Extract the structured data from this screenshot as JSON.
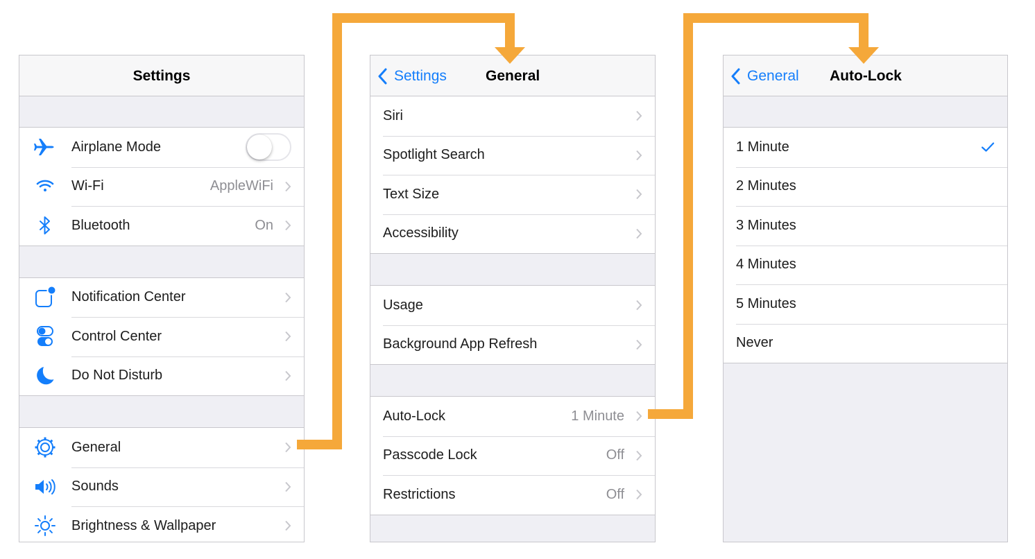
{
  "colors": {
    "accent": "#147efb",
    "connector": "#f5a83a",
    "background": "#efeff4",
    "secondary_text": "#8e8e93"
  },
  "screens": {
    "settings": {
      "title": "Settings",
      "groups": [
        [
          {
            "label": "Airplane Mode",
            "icon": "airplane-icon",
            "control": "toggle",
            "toggle_on": false
          },
          {
            "label": "Wi-Fi",
            "icon": "wifi-icon",
            "value": "AppleWiFi"
          },
          {
            "label": "Bluetooth",
            "icon": "bluetooth-icon",
            "value": "On"
          }
        ],
        [
          {
            "label": "Notification Center",
            "icon": "notification-center-icon"
          },
          {
            "label": "Control Center",
            "icon": "control-center-icon"
          },
          {
            "label": "Do Not Disturb",
            "icon": "moon-icon"
          }
        ],
        [
          {
            "label": "General",
            "icon": "gear-icon"
          },
          {
            "label": "Sounds",
            "icon": "speaker-icon"
          },
          {
            "label": "Brightness & Wallpaper",
            "icon": "sun-icon"
          }
        ]
      ]
    },
    "general": {
      "back_label": "Settings",
      "title": "General",
      "groups": [
        [
          {
            "label": "Siri"
          },
          {
            "label": "Spotlight Search"
          },
          {
            "label": "Text Size"
          },
          {
            "label": "Accessibility"
          }
        ],
        [
          {
            "label": "Usage"
          },
          {
            "label": "Background App Refresh"
          }
        ],
        [
          {
            "label": "Auto-Lock",
            "value": "1 Minute"
          },
          {
            "label": "Passcode Lock",
            "value": "Off"
          },
          {
            "label": "Restrictions",
            "value": "Off"
          }
        ]
      ]
    },
    "autolock": {
      "back_label": "General",
      "title": "Auto-Lock",
      "options": [
        "1 Minute",
        "2 Minutes",
        "3 Minutes",
        "4 Minutes",
        "5 Minutes",
        "Never"
      ],
      "selected": "1 Minute"
    }
  }
}
